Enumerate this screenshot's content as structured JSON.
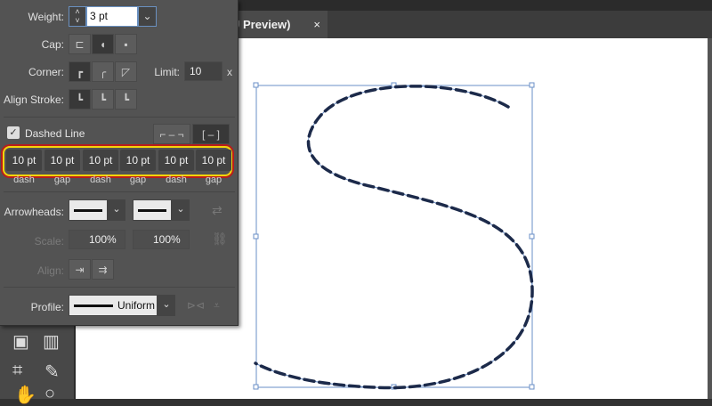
{
  "document_tab": {
    "title": "U Preview)",
    "close": "×"
  },
  "stroke_panel": {
    "weight": {
      "label": "Weight:",
      "value": "3 pt"
    },
    "cap": {
      "label": "Cap:"
    },
    "corner": {
      "label": "Corner:",
      "limit_label": "Limit:",
      "limit_value": "10",
      "limit_suffix": "x"
    },
    "align_stroke": {
      "label": "Align Stroke:"
    },
    "dashed_line": {
      "label": "Dashed Line",
      "checked": true
    },
    "dash_fields": [
      {
        "value": "10 pt",
        "label": "dash"
      },
      {
        "value": "10 pt",
        "label": "gap"
      },
      {
        "value": "10 pt",
        "label": "dash"
      },
      {
        "value": "10 pt",
        "label": "gap"
      },
      {
        "value": "10 pt",
        "label": "dash"
      },
      {
        "value": "10 pt",
        "label": "gap"
      }
    ],
    "arrowheads": {
      "label": "Arrowheads:"
    },
    "scale": {
      "label": "Scale:",
      "start": "100%",
      "end": "100%"
    },
    "align": {
      "label": "Align:"
    },
    "profile": {
      "label": "Profile:",
      "value": "Uniform"
    }
  },
  "colors": {
    "stroke": "#1c2a4a",
    "selection": "#6a8fc7",
    "highlight": "#f5d40a"
  }
}
